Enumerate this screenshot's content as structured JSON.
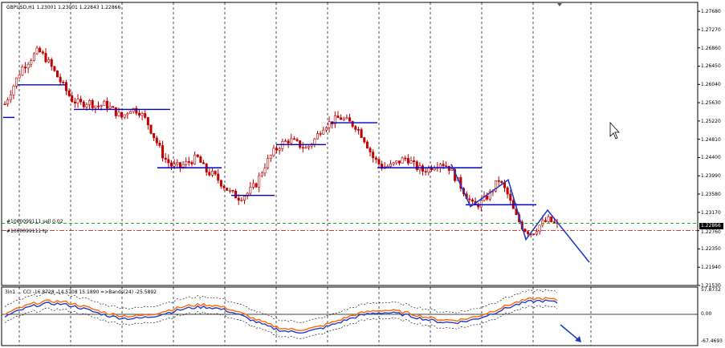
{
  "window": {
    "title": "GBPUSD,H1  1.23001 1.23001 1.22843 1.22866"
  },
  "price_axis": {
    "labels": [
      "1.27680",
      "1.27270",
      "1.26860",
      "1.26450",
      "1.26040",
      "1.25630",
      "1.25220",
      "1.24810",
      "1.24400",
      "1.23990",
      "1.23580",
      "1.23170",
      "1.22760",
      "1.22350",
      "1.21940",
      "1.21530"
    ],
    "current_price": "1.22866",
    "colors": {
      "tag_bg": "#000000",
      "tag_fg": "#ffffff"
    }
  },
  "order_labels": {
    "sell": "#1060099111 sell 0.02",
    "tp": "#1060099111 tp"
  },
  "indicator": {
    "title": "3in1 ... CCI -16.8728 -14.5708 15.1890 =>Bands(24) -25.5892",
    "axis_labels": [
      "57.8732",
      "0.00",
      "-67.4693"
    ]
  },
  "colors": {
    "candle": "#c00000",
    "levels": "#0000c8",
    "zigzag": "#1e3ec8",
    "grid": "#000000",
    "sell_line": "#00a000",
    "tp_line": "#c00000",
    "cci_orange": "#ff6600",
    "cci_blue": "#1e3ec8"
  },
  "chart_data": {
    "type": "candlestick",
    "symbol": "GBPUSD",
    "timeframe": "H1",
    "ohlc_last": {
      "open": 1.23001,
      "high": 1.23001,
      "low": 1.22843,
      "close": 1.22866
    },
    "ylim": [
      1.2153,
      1.2788
    ],
    "trend_closes": [
      1.256,
      1.26,
      1.264,
      1.266,
      1.268,
      1.266,
      1.263,
      1.26,
      1.257,
      1.256,
      1.2565,
      1.2555,
      1.256,
      1.2545,
      1.253,
      1.255,
      1.2545,
      1.252,
      1.248,
      1.244,
      1.242,
      1.242,
      1.243,
      1.244,
      1.241,
      1.24,
      1.238,
      1.236,
      1.235,
      1.236,
      1.238,
      1.242,
      1.245,
      1.247,
      1.248,
      1.247,
      1.246,
      1.248,
      1.251,
      1.252,
      1.253,
      1.252,
      1.251,
      1.248,
      1.244,
      1.242,
      1.242,
      1.243,
      1.244,
      1.242,
      1.241,
      1.242,
      1.243,
      1.242,
      1.239,
      1.236,
      1.233,
      1.234,
      1.236,
      1.239,
      1.236,
      1.231,
      1.228,
      1.227,
      1.229,
      1.23,
      1.2287
    ],
    "horizontal_levels": [
      1.253,
      1.2603,
      1.2548,
      1.2417,
      1.2355,
      1.2469,
      1.2518,
      1.2417,
      1.2334
    ],
    "order_levels": {
      "sell": 1.22925,
      "tp": 1.2276
    }
  }
}
